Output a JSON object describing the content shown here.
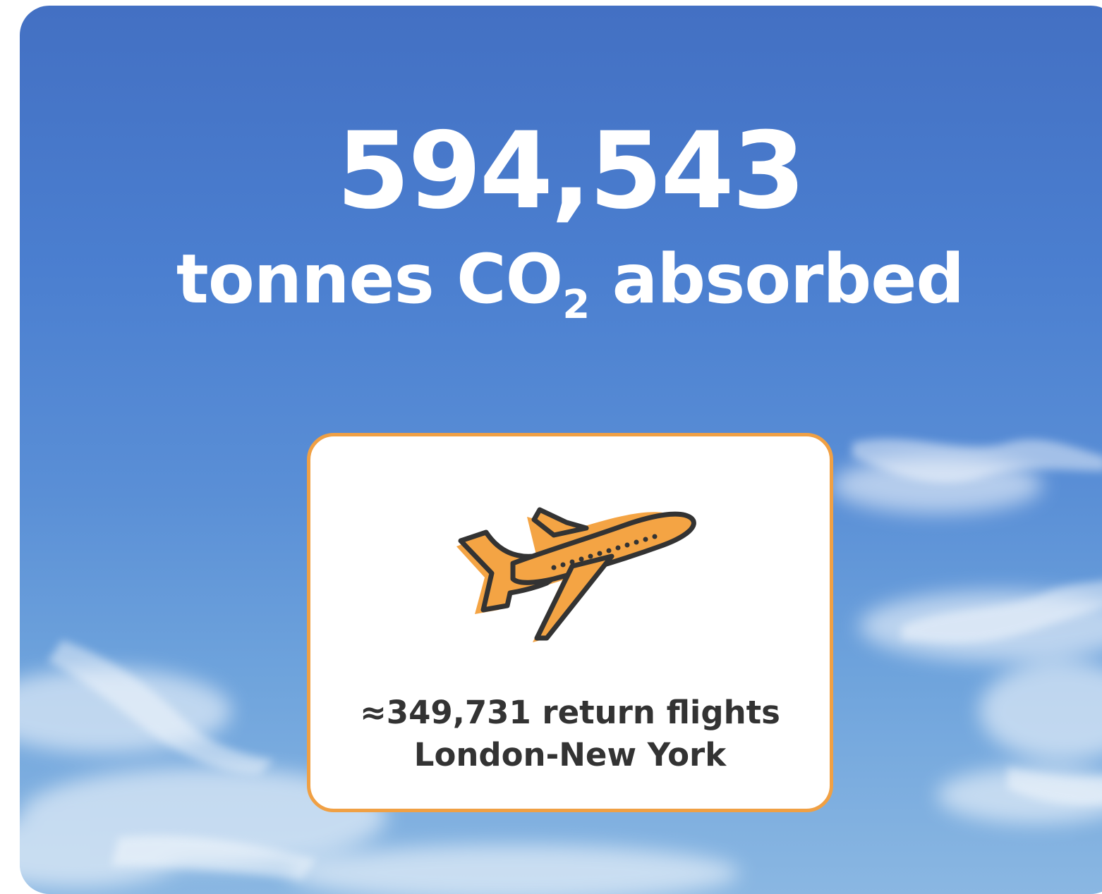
{
  "headline": {
    "number": "594,543",
    "unit_prefix": "tonnes CO",
    "unit_subscript": "2",
    "unit_suffix": " absorbed"
  },
  "equivalence": {
    "icon": "airplane-icon",
    "line1": "≈349,731 return flights",
    "line2": "London-New York",
    "border_color": "#f0a044",
    "icon_fill": "#f4a444",
    "icon_stroke": "#333333"
  },
  "colors": {
    "sky_top": "#4370c3",
    "sky_bottom": "#8ab7e2",
    "text_white": "#ffffff",
    "text_dark": "#333333"
  }
}
